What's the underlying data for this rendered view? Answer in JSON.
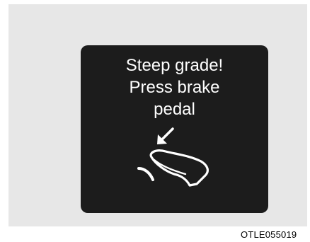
{
  "message": {
    "line1": "Steep grade!",
    "line2": "Press brake",
    "line3": "pedal"
  },
  "figure_code": "OTLE055019",
  "icon": {
    "name": "foot-press-brake-pedal-icon"
  },
  "colors": {
    "panel_background": "#1c1c1c",
    "figure_background": "#e7e7e7",
    "text": "#ffffff"
  }
}
